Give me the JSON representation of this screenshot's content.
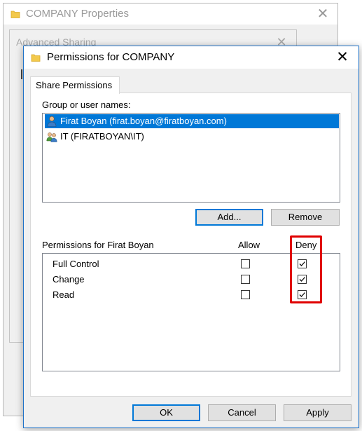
{
  "background_windows": {
    "properties_title": "COMPANY Properties",
    "advanced_sharing_title": "Advanced Sharing"
  },
  "dialog": {
    "title": "Permissions for COMPANY",
    "tab_label": "Share Permissions",
    "group_label": "Group or user names:",
    "users": [
      {
        "name": "Firat Boyan (firat.boyan@firatboyan.com)",
        "icon": "user-icon",
        "selected": true
      },
      {
        "name": "IT (FIRATBOYAN\\IT)",
        "icon": "group-icon",
        "selected": false
      }
    ],
    "add_button": "Add...",
    "remove_button": "Remove",
    "permissions_label": "Permissions for Firat Boyan",
    "allow_header": "Allow",
    "deny_header": "Deny",
    "permissions": [
      {
        "name": "Full Control",
        "allow": false,
        "deny": true
      },
      {
        "name": "Change",
        "allow": false,
        "deny": true
      },
      {
        "name": "Read",
        "allow": false,
        "deny": true
      }
    ],
    "ok_button": "OK",
    "cancel_button": "Cancel",
    "apply_button": "Apply"
  },
  "colors": {
    "selection": "#0078d7",
    "highlight_box": "#e00000",
    "dialog_border": "#1e72c8"
  }
}
